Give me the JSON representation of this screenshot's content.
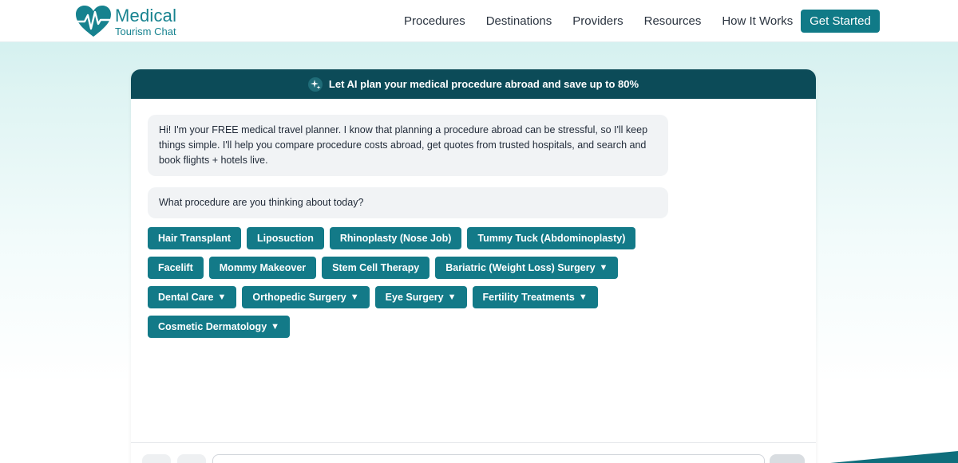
{
  "header": {
    "logo_main": "Medical",
    "logo_sub": "Tourism Chat",
    "nav": [
      "Procedures",
      "Destinations",
      "Providers",
      "Resources",
      "How It Works"
    ],
    "cta": "Get Started"
  },
  "chat": {
    "banner": "Let AI plan your medical procedure abroad and save up to 80%",
    "messages": [
      "Hi! I'm your FREE medical travel planner. I know that planning a procedure abroad can be stressful, so I'll keep things simple. I'll help you compare procedure costs abroad, get quotes from trusted hospitals, and search and book flights + hotels live.",
      "What procedure are you thinking about today?"
    ],
    "chips": [
      "Hair Transplant",
      "Liposuction",
      "Rhinoplasty (Nose Job)",
      "Tummy Tuck (Abdominoplasty)",
      "Facelift",
      "Mommy Makeover",
      "Stem Cell Therapy",
      "Bariatric (Weight Loss) Surgery",
      "Dental Care",
      "Orthopedic Surgery",
      "Eye Surgery",
      "Fertility Treatments",
      "Cosmetic Dermatology"
    ],
    "caret": "▼"
  },
  "colors": {
    "brand": "#16828f",
    "banner": "#0c4b58",
    "chip": "#137a88",
    "cta": "#107a87"
  },
  "icons": [
    "heart-pulse-logo-icon",
    "sparkle-icon",
    "chevron-down-icon"
  ]
}
